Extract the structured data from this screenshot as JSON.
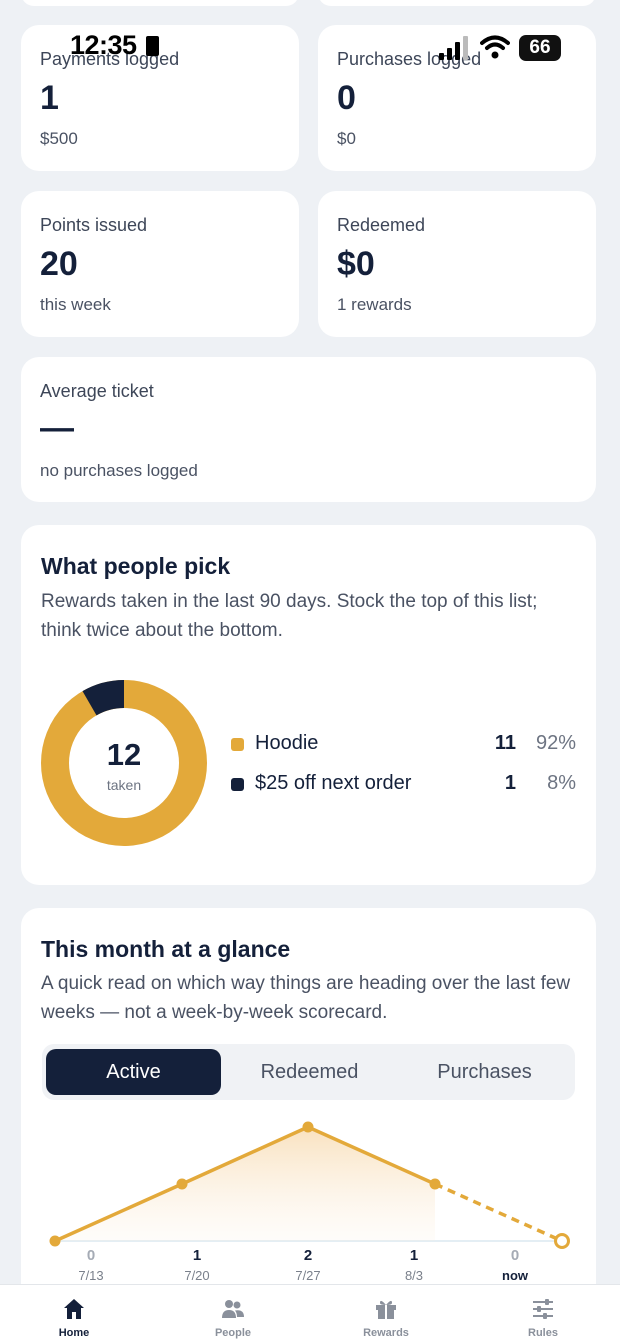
{
  "status_bar": {
    "time": "12:35",
    "battery": "66"
  },
  "stats": {
    "payments": {
      "label": "Payments logged",
      "value": "1",
      "sub": "$500"
    },
    "purchases": {
      "label": "Purchases logged",
      "value": "0",
      "sub": "$0"
    },
    "points": {
      "label": "Points issued",
      "value": "20",
      "sub": "this week"
    },
    "redeemed": {
      "label": "Redeemed",
      "value": "$0",
      "sub": "1 rewards"
    },
    "avg_ticket": {
      "label": "Average ticket",
      "value": "—",
      "sub": "no purchases logged"
    }
  },
  "picks": {
    "title": "What people pick",
    "description": "Rewards taken in the last 90 days. Stock the top of this list; think twice about the bottom.",
    "total": "12",
    "total_label": "taken",
    "items": [
      {
        "name": "Hoodie",
        "count": "11",
        "pct": "92%",
        "color": "#e3a93a"
      },
      {
        "name": "$25 off next order",
        "count": "1",
        "pct": "8%",
        "color": "#14203a"
      }
    ]
  },
  "glance": {
    "title": "This month at a glance",
    "description": "A quick read on which way things are heading over the last few weeks — not a week-by-week scorecard.",
    "tabs": [
      {
        "label": "Active",
        "active": true
      },
      {
        "label": "Redeemed",
        "active": false
      },
      {
        "label": "Purchases",
        "active": false
      }
    ]
  },
  "chart_data": {
    "type": "line",
    "categories": [
      "7/13",
      "7/20",
      "7/27",
      "8/3",
      "now"
    ],
    "values": [
      0,
      1,
      2,
      1,
      0
    ],
    "value_labels": [
      "0",
      "1",
      "2",
      "1",
      "0"
    ],
    "color": "#e3a93a",
    "projected_last_segment": true
  },
  "tabbar": [
    {
      "label": "Home",
      "icon": "home-icon",
      "active": true
    },
    {
      "label": "People",
      "icon": "people-icon",
      "active": false
    },
    {
      "label": "Rewards",
      "icon": "gift-icon",
      "active": false
    },
    {
      "label": "Rules",
      "icon": "sliders-icon",
      "active": false
    }
  ]
}
